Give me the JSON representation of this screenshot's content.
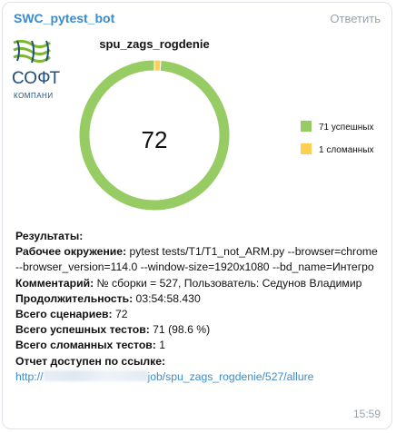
{
  "message": {
    "sender": "SWC_pytest_bot",
    "reply_label": "Ответить",
    "time": "15:59"
  },
  "logo": {
    "text_main": "СОФТ",
    "text_sub": "КОМПАНИ",
    "colors": {
      "green": "#7cb82f",
      "dark": "#1f4f7a"
    }
  },
  "chart_data": {
    "type": "pie",
    "title": "spu_zags_rogdenie",
    "center_label": "72",
    "slices": [
      {
        "label": "71 успешных",
        "value": 71,
        "color": "#97cc64"
      },
      {
        "label": "1 сломанных",
        "value": 1,
        "color": "#ffd050"
      }
    ],
    "legend_position": "right"
  },
  "results": {
    "heading": "Результаты:",
    "env_label": "Рабочее окружение:",
    "env_value": " pytest tests/T1/T1_not_ARM.py --browser=chrome --browser_version=114.0 --window-size=1920x1080 --bd_name=Интегро",
    "comment_label": "Комментарий:",
    "comment_value": " № сборки = 527, Пользователь: Седунов Владимир",
    "duration_label": "Продолжительность:",
    "duration_value": " 03:54:58.430",
    "scenarios_label": "Всего сценариев:",
    "scenarios_value": " 72",
    "passed_label": "Всего успешных тестов:",
    "passed_value": " 71 (98.6 %)",
    "broken_label": "Всего сломанных тестов:",
    "broken_value": " 1",
    "report_label": "Отчет доступен по ссылке:",
    "link_prefix": "http://",
    "link_suffix": "job/spu_zags_rogdenie/527/allure"
  }
}
